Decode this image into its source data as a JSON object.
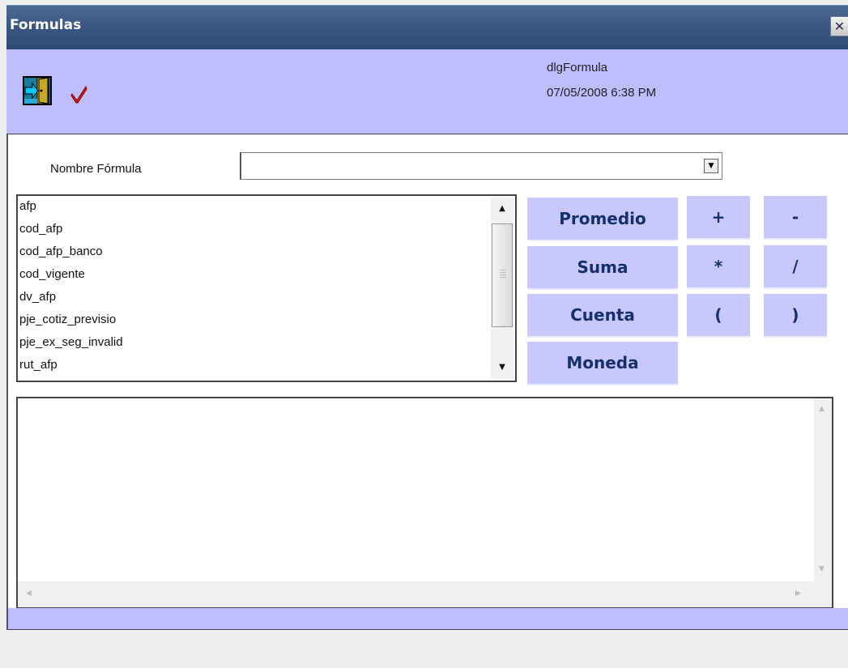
{
  "window": {
    "title": "Formulas",
    "close_glyph": "✕"
  },
  "header": {
    "dialog_name": "dlgFormula",
    "datetime": "07/05/2008 6:38 PM",
    "icons": [
      "exit-door-icon",
      "checkmark-icon"
    ]
  },
  "form": {
    "name_label": "Nombre Fórmula",
    "name_value": ""
  },
  "field_list": {
    "items": [
      "afp",
      "cod_afp",
      "cod_afp_banco",
      "cod_vigente",
      "dv_afp",
      "pje_cotiz_previsio",
      "pje_ex_seg_invalid",
      "rut_afp"
    ]
  },
  "buttons": {
    "promedio": "Promedio",
    "suma": "Suma",
    "cuenta": "Cuenta",
    "moneda": "Moneda",
    "plus": "+",
    "minus": "-",
    "multiply": "*",
    "divide": "/",
    "open_paren": "(",
    "close_paren": ")"
  },
  "formula": {
    "text": ""
  },
  "colors": {
    "title_bar": "#3a5884",
    "band": "#bebeff",
    "button_bg": "#c8c8ff",
    "button_text": "#15306b"
  }
}
